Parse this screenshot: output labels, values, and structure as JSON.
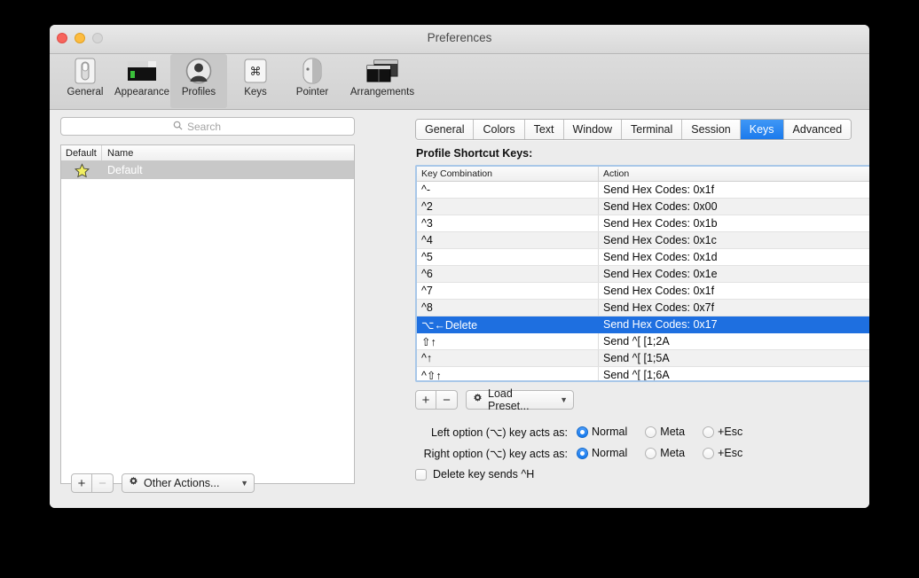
{
  "window": {
    "title": "Preferences",
    "traffic_lights": [
      "close-button",
      "minimize-button",
      "zoom-button"
    ]
  },
  "toolbar": {
    "items": [
      {
        "label": "General",
        "icon": "general-switch-icon",
        "selected": false
      },
      {
        "label": "Appearance",
        "icon": "appearance-window-icon",
        "selected": false
      },
      {
        "label": "Profiles",
        "icon": "profiles-person-icon",
        "selected": true
      },
      {
        "label": "Keys",
        "icon": "keys-command-icon",
        "selected": false
      },
      {
        "label": "Pointer",
        "icon": "pointer-mouse-icon",
        "selected": false
      },
      {
        "label": "Arrangements",
        "icon": "arrangements-windows-icon",
        "selected": false
      }
    ]
  },
  "sidebar": {
    "search": {
      "placeholder": "Search",
      "value": "",
      "icon": "search-icon"
    },
    "list": {
      "columns": [
        "Default",
        "Name"
      ],
      "rows": [
        {
          "name": "Default",
          "is_default": true,
          "star_icon": "star-icon",
          "selected": true
        }
      ]
    },
    "actions": {
      "add_label": "+",
      "remove_label": "−",
      "popup_label": "Other Actions...",
      "gear_icon": "gear-icon",
      "chevron_icon": "chevron-down-icon",
      "remove_disabled": true
    }
  },
  "main": {
    "tabs": [
      {
        "label": "General",
        "active": false
      },
      {
        "label": "Colors",
        "active": false
      },
      {
        "label": "Text",
        "active": false
      },
      {
        "label": "Window",
        "active": false
      },
      {
        "label": "Terminal",
        "active": false
      },
      {
        "label": "Session",
        "active": false
      },
      {
        "label": "Keys",
        "active": true
      },
      {
        "label": "Advanced",
        "active": false
      }
    ],
    "section_title": "Profile Shortcut Keys:",
    "table": {
      "columns": [
        "Key Combination",
        "Action"
      ],
      "rows": [
        {
          "key": "^-",
          "action": "Send Hex Codes: 0x1f",
          "selected": false
        },
        {
          "key": "^2",
          "action": "Send Hex Codes: 0x00",
          "selected": false
        },
        {
          "key": "^3",
          "action": "Send Hex Codes: 0x1b",
          "selected": false
        },
        {
          "key": "^4",
          "action": "Send Hex Codes: 0x1c",
          "selected": false
        },
        {
          "key": "^5",
          "action": "Send Hex Codes: 0x1d",
          "selected": false
        },
        {
          "key": "^6",
          "action": "Send Hex Codes: 0x1e",
          "selected": false
        },
        {
          "key": "^7",
          "action": "Send Hex Codes: 0x1f",
          "selected": false
        },
        {
          "key": "^8",
          "action": "Send Hex Codes: 0x7f",
          "selected": false
        },
        {
          "key": "⌥←Delete",
          "action": "Send Hex Codes: 0x17",
          "selected": true
        },
        {
          "key": "⇧↑",
          "action": "Send ^[ [1;2A",
          "selected": false
        },
        {
          "key": "^↑",
          "action": "Send ^[ [1;5A",
          "selected": false
        },
        {
          "key": "^⇧↑",
          "action": "Send ^[ [1;6A",
          "selected": false
        }
      ]
    },
    "preset_bar": {
      "add_label": "+",
      "remove_label": "−",
      "popup_label": "Load Preset...",
      "gear_icon": "gear-icon",
      "chevron_icon": "chevron-down-icon"
    },
    "options": [
      {
        "label": "Left option (⌥) key acts as:",
        "choices": [
          {
            "label": "Normal",
            "checked": true
          },
          {
            "label": "Meta",
            "checked": false
          },
          {
            "label": "+Esc",
            "checked": false
          }
        ]
      },
      {
        "label": "Right option (⌥) key acts as:",
        "choices": [
          {
            "label": "Normal",
            "checked": true
          },
          {
            "label": "Meta",
            "checked": false
          },
          {
            "label": "+Esc",
            "checked": false
          }
        ]
      }
    ],
    "delete_checkbox": {
      "label": "Delete key sends ^H",
      "checked": false
    }
  },
  "colors": {
    "accent_blue": "#1e6fe0",
    "tab_active_blue": "#1b7aec",
    "window_bg": "#ececec",
    "table_border": "#a8c7e8",
    "star_yellow": "#f2ef62"
  }
}
